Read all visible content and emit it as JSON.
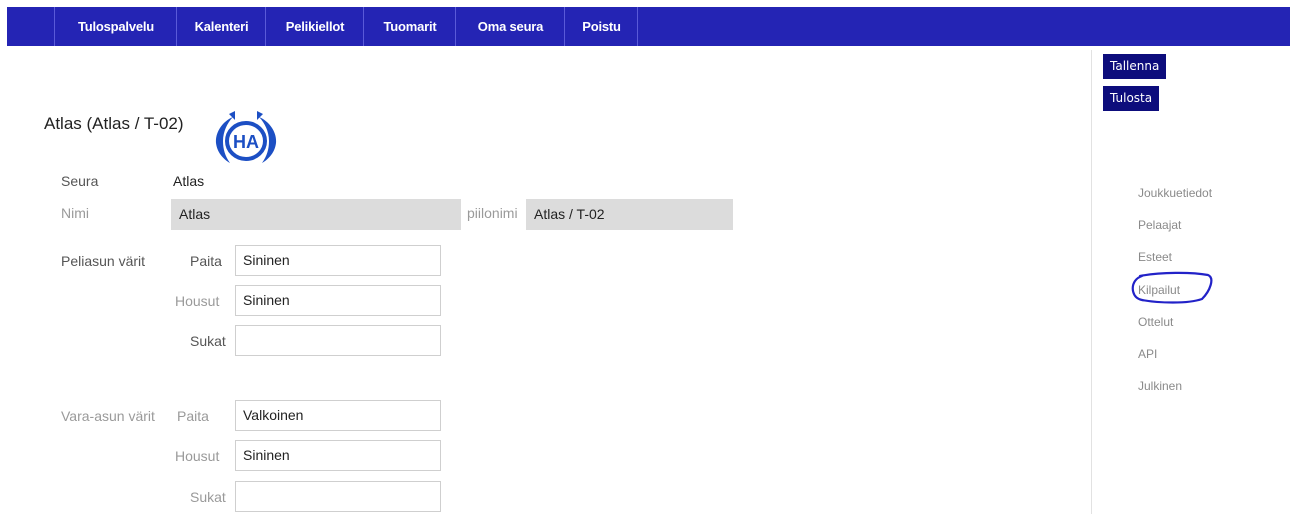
{
  "nav": {
    "items": [
      {
        "label": "Tulospalvelu"
      },
      {
        "label": "Kalenteri"
      },
      {
        "label": "Pelikiellot"
      },
      {
        "label": "Tuomarit"
      },
      {
        "label": "Oma seura"
      },
      {
        "label": "Poistu"
      }
    ],
    "background_color": "#2424b4"
  },
  "actions": {
    "save_label": "Tallenna",
    "print_label": "Tulosta",
    "button_color": "#0d0d7c"
  },
  "sidebar": {
    "items": [
      {
        "label": "Joukkuetiedot"
      },
      {
        "label": "Pelaajat"
      },
      {
        "label": "Esteet"
      },
      {
        "label": "Kilpailut",
        "annotated": true
      },
      {
        "label": "Ottelut"
      },
      {
        "label": "API"
      },
      {
        "label": "Julkinen"
      }
    ],
    "annotation_color": "#2222c8"
  },
  "team": {
    "title": "Atlas (Atlas / T-02)",
    "logo_text": "HA",
    "club_label": "Seura",
    "club_value": "Atlas",
    "name_label": "Nimi",
    "name_value": "Atlas",
    "abbr_label": "piilonimi",
    "abbr_value": "Atlas / T-02"
  },
  "kit": {
    "home_label": "Peliasun värit",
    "away_label": "Vara-asun värit",
    "shirt_label": "Paita",
    "shorts_label": "Housut",
    "socks_label": "Sukat",
    "home": {
      "shirt": "Sininen",
      "shorts": "Sininen",
      "socks": ""
    },
    "away": {
      "shirt": "Valkoinen",
      "shorts": "Sininen",
      "socks": ""
    }
  }
}
